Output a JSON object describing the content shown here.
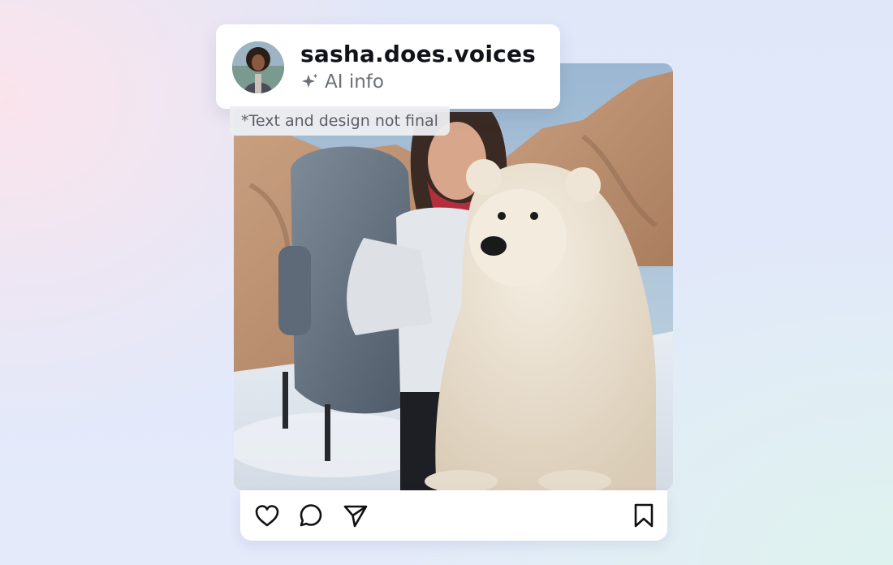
{
  "profile": {
    "username": "sasha.does.voices",
    "ai_label": "AI info",
    "ai_icon": "sparkle-icon",
    "avatar": "user-avatar"
  },
  "disclaimer": "*Text and design not final",
  "post": {
    "image": "hiker-with-backpack-and-polar-bear-in-desert-snow-photo"
  },
  "actions": {
    "like_icon": "heart-icon",
    "comment_icon": "comment-icon",
    "share_icon": "send-icon",
    "save_icon": "bookmark-icon"
  }
}
